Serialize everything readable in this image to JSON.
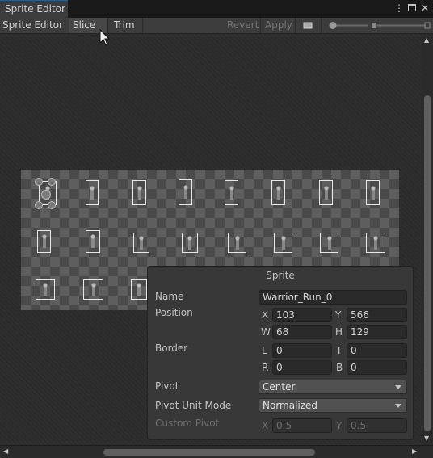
{
  "window": {
    "title": "Sprite Editor"
  },
  "toolbar": {
    "mode_label": "Sprite Editor",
    "slice_label": "Slice",
    "trim_label": "Trim",
    "revert_label": "Revert",
    "apply_label": "Apply"
  },
  "panel": {
    "title": "Sprite",
    "name_label": "Name",
    "name_value": "Warrior_Run_0",
    "position_label": "Position",
    "x_label": "X",
    "x_value": "103",
    "y_label": "Y",
    "y_value": "566",
    "w_label": "W",
    "w_value": "68",
    "h_label": "H",
    "h_value": "129",
    "border_label": "Border",
    "l_label": "L",
    "l_value": "0",
    "t_label": "T",
    "t_value": "0",
    "r_label": "R",
    "r_value": "0",
    "b_label": "B",
    "b_value": "0",
    "pivot_label": "Pivot",
    "pivot_value": "Center",
    "pivot_unit_label": "Pivot Unit Mode",
    "pivot_unit_value": "Normalized",
    "custom_pivot_label": "Custom Pivot",
    "cx_label": "X",
    "cx_value": "0.5",
    "cy_label": "Y",
    "cy_value": "0.5"
  },
  "icons": [
    "kebab-menu-icon",
    "maximize-icon",
    "close-icon",
    "color-toggle-icon",
    "zoom-slider-icon",
    "cursor-icon"
  ]
}
